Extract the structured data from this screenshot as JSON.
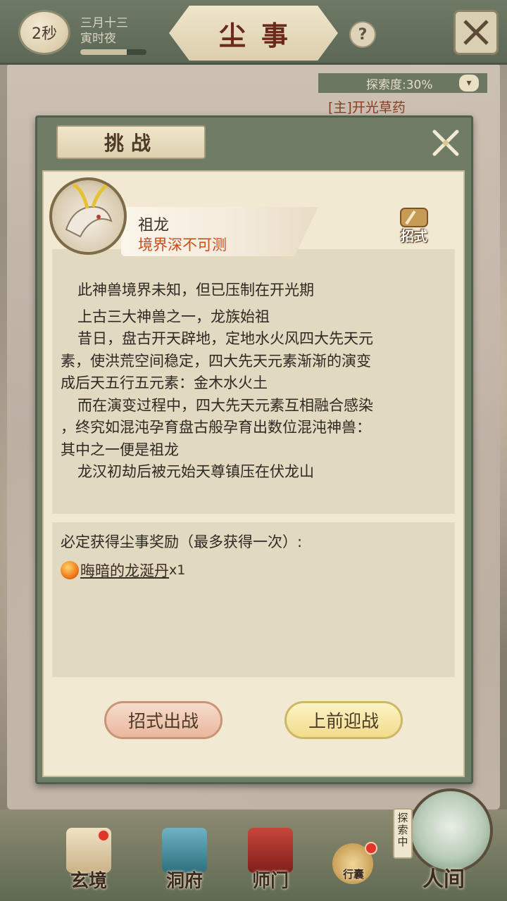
{
  "header": {
    "timer": "2秒",
    "date_line1": "三月十三",
    "date_line2": "寅时夜",
    "time_progress": 0.7,
    "title": "尘事",
    "help": "?"
  },
  "explore": {
    "progress_label": "探索度:30%",
    "task": "[主]开光草药"
  },
  "dialog": {
    "tab_title": "挑战",
    "boss_name": "祖龙",
    "boss_realm": "境界深不可测",
    "skill_label": "招式",
    "description": [
      "此神兽境界未知，但已压制在开光期",
      "上古三大神兽之一，龙族始祖",
      "昔日，盘古开天辟地，定地水火风四大先天元",
      "素，使洪荒空间稳定，四大先天元素渐渐的演变",
      "成后天五行五元素：金木水火土",
      "而在演变过程中，四大先天元素互相融合感染",
      "，终究如混沌孕育盘古般孕育出数位混沌神兽：",
      "其中之一便是祖龙",
      "龙汉初劫后被元始天尊镇压在伏龙山"
    ],
    "reward_title": "必定获得尘事奖励（最多获得一次）:",
    "reward_item": "晦暗的龙涎丹",
    "reward_qty": "x1",
    "btn_skill": "招式出战",
    "btn_fight": "上前迎战"
  },
  "nav": {
    "items": [
      "玄境",
      "洞府",
      "师门",
      "行囊",
      "人间"
    ],
    "explore_tag": "探索中"
  },
  "colors": {
    "realm_red": "#d04a1a",
    "title_red": "#6b2a1c",
    "dialog_frame": "#6f7c66",
    "paper": "#f1e9d1"
  }
}
